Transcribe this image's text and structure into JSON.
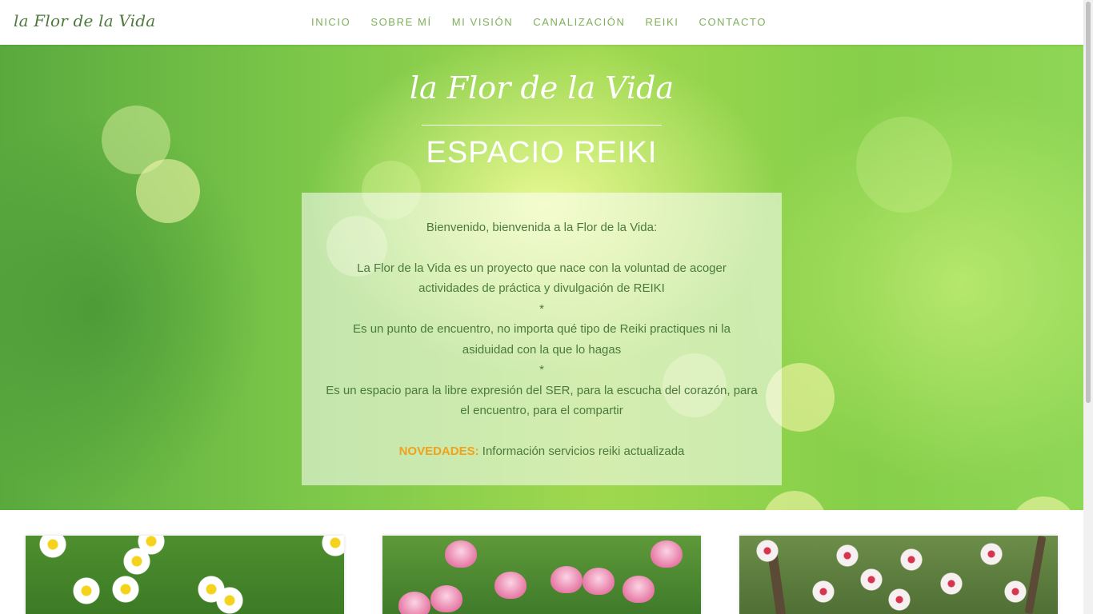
{
  "header": {
    "logo_text": "la Flor de la Vida",
    "nav": [
      "INICIO",
      "SOBRE MÍ",
      "MI VISIÓN",
      "CANALIZACIÓN",
      "REIKI",
      "CONTACTO"
    ]
  },
  "hero": {
    "script_title": "la Flor de la Vida",
    "title": "ESPACIO REIKI",
    "welcome": {
      "greeting": "Bienvenido, bienvenida a la Flor de la Vida:",
      "paragraph_1": "La Flor de la Vida es un proyecto que nace con la voluntad de acoger actividades de práctica y divulgación de REIKI",
      "separator": "*",
      "paragraph_2": "Es un punto de encuentro, no importa qué tipo de Reiki practiques ni la asiduidad con la que lo hagas",
      "paragraph_3": "Es un espacio para la libre expresión del SER, para la escucha del corazón, para el encuentro, para el compartir",
      "novedades_label": "NOVEDADES:",
      "novedades_text": "Información servicios reiki actualizada"
    }
  },
  "colors": {
    "accent_green": "#7db05a",
    "text_green": "#4b7a3d",
    "novedades_orange": "#f0a21a"
  },
  "cards": [
    {
      "image": "daisies-photo"
    },
    {
      "image": "pink-tulips-photo"
    },
    {
      "image": "almond-blossom-photo"
    }
  ]
}
